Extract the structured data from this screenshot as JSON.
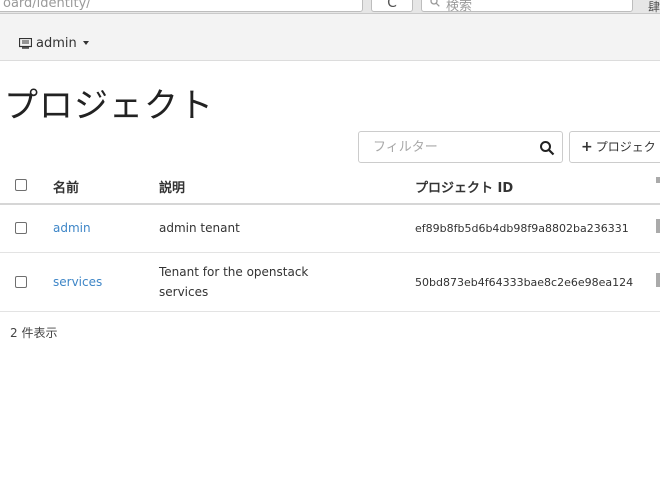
{
  "browser": {
    "url": "oard/identity/",
    "reload_glyph": "C",
    "search_placeholder": "検索",
    "extra_glyph": "肆"
  },
  "top_nav": {
    "project_label": "admin",
    "project_icon": "monitor-icon"
  },
  "page": {
    "title": "プロジェクト"
  },
  "filter": {
    "placeholder": "フィルター",
    "value": ""
  },
  "create_button": {
    "label": "プロジェク"
  },
  "table": {
    "headers": {
      "name": "名前",
      "description": "説明",
      "project_id": "プロジェクト ID"
    },
    "rows": [
      {
        "name": "admin",
        "description_line1": "admin tenant",
        "description_line2": "",
        "project_id": "ef89b8fb5d6b4db98f9a8802ba236331"
      },
      {
        "name": "services",
        "description_line1": "Tenant for the openstack",
        "description_line2": "services",
        "project_id": "50bd873eb4f64333bae8c2e6e98ea124"
      }
    ],
    "count_text": "2 件表示"
  },
  "colors": {
    "link": "#3e86c7",
    "nav_bg": "#f3f3f3"
  }
}
